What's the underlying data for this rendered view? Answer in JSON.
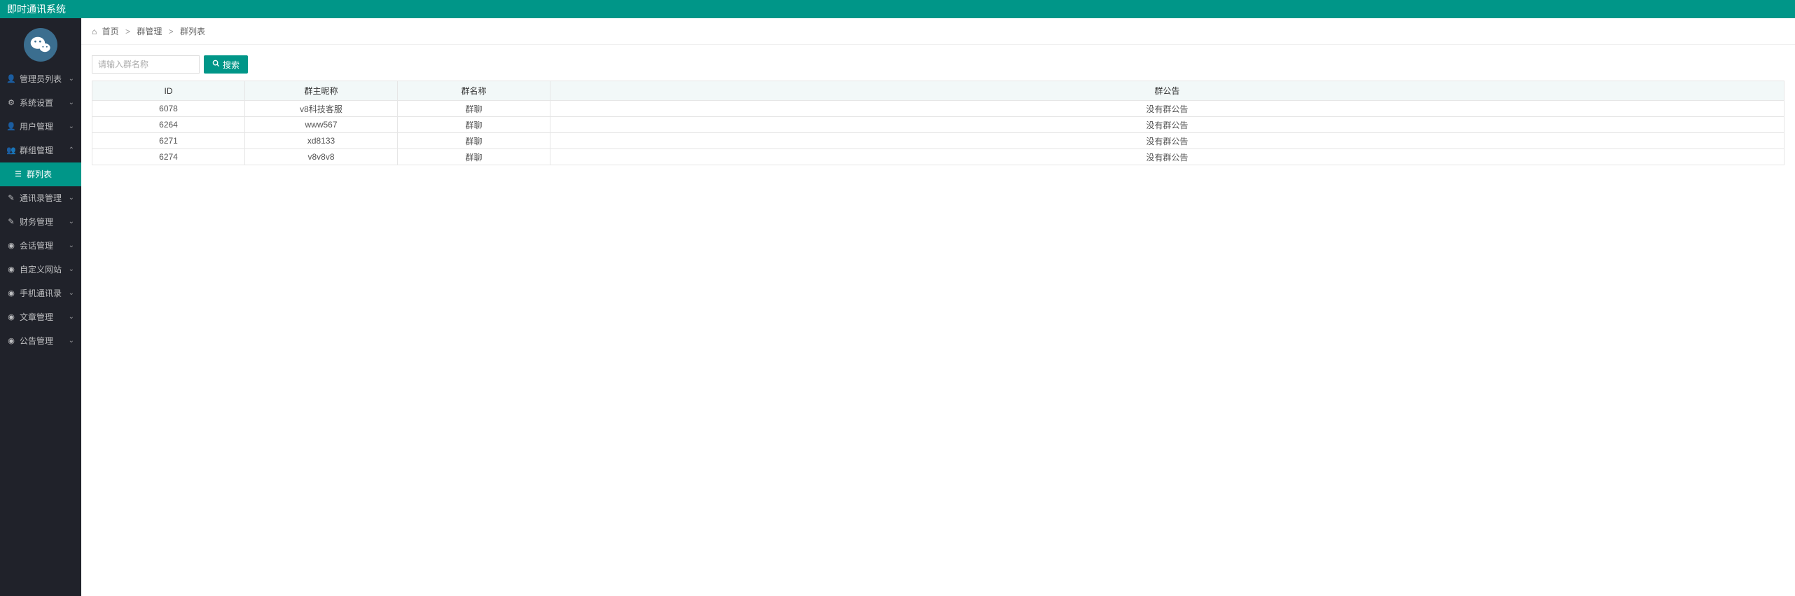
{
  "app_title": "即时通讯系统",
  "breadcrumb": {
    "home": "首页",
    "section": "群管理",
    "page": "群列表"
  },
  "search": {
    "placeholder": "请输入群名称",
    "button": "搜索"
  },
  "sidebar": {
    "items": [
      {
        "label": "管理员列表"
      },
      {
        "label": "系统设置"
      },
      {
        "label": "用户管理"
      },
      {
        "label": "群组管理"
      },
      {
        "label": "通讯录管理"
      },
      {
        "label": "财务管理"
      },
      {
        "label": "会话管理"
      },
      {
        "label": "自定义网站"
      },
      {
        "label": "手机通讯录"
      },
      {
        "label": "文章管理"
      },
      {
        "label": "公告管理"
      }
    ],
    "active_sub": "群列表"
  },
  "table": {
    "headers": [
      "ID",
      "群主昵称",
      "群名称",
      "群公告"
    ],
    "rows": [
      {
        "id": "6078",
        "owner": "v8科技客服",
        "name": "群聊",
        "notice": "没有群公告"
      },
      {
        "id": "6264",
        "owner": "www567",
        "name": "群聊",
        "notice": "没有群公告"
      },
      {
        "id": "6271",
        "owner": "xd8133",
        "name": "群聊",
        "notice": "没有群公告"
      },
      {
        "id": "6274",
        "owner": "v8v8v8",
        "name": "群聊",
        "notice": "没有群公告"
      }
    ]
  }
}
